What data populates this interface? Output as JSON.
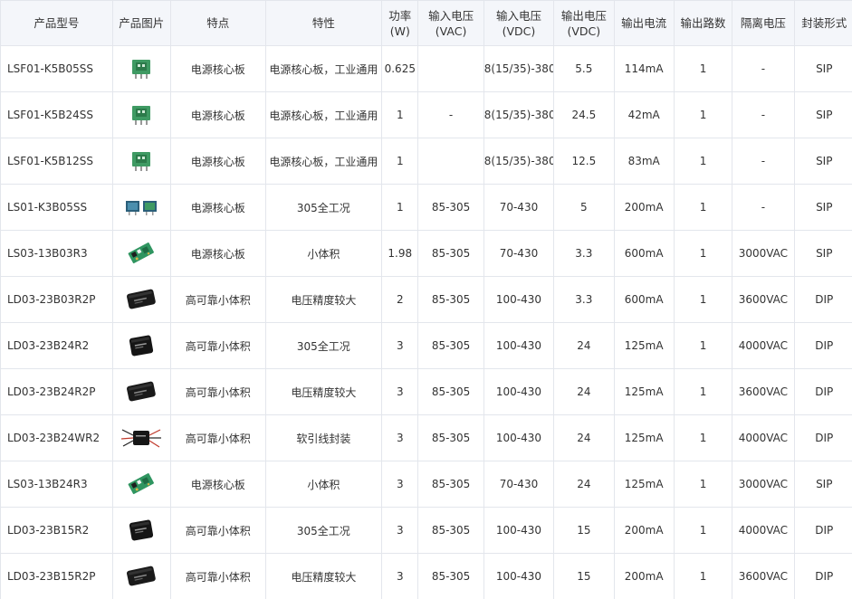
{
  "table": {
    "headers": [
      "产品型号",
      "产品图片",
      "特点",
      "特性",
      "功率\n(W)",
      "输入电压\n(VAC)",
      "输入电压\n(VDC)",
      "输出电压\n(VDC)",
      "输出电流",
      "输出路数",
      "隔离电压",
      "封装形式"
    ],
    "rows": [
      {
        "model": "LSF01-K5B05SS",
        "image": "green-sip-module-icon",
        "feature": "电源核心板",
        "character": "电源核心板，工业通用",
        "power": "0.625",
        "vac": "",
        "vdc": "8(15/35)-380",
        "vout": "5.5",
        "iout": "114mA",
        "channels": "1",
        "isolation": "-",
        "package": "SIP"
      },
      {
        "model": "LSF01-K5B24SS",
        "image": "green-sip-module-icon",
        "feature": "电源核心板",
        "character": "电源核心板，工业通用",
        "power": "1",
        "vac": "-",
        "vdc": "8(15/35)-380",
        "vout": "24.5",
        "iout": "42mA",
        "channels": "1",
        "isolation": "-",
        "package": "SIP"
      },
      {
        "model": "LSF01-K5B12SS",
        "image": "green-sip-module-icon",
        "feature": "电源核心板",
        "character": "电源核心板，工业通用",
        "power": "1",
        "vac": "",
        "vdc": "8(15/35)-380",
        "vout": "12.5",
        "iout": "83mA",
        "channels": "1",
        "isolation": "-",
        "package": "SIP"
      },
      {
        "model": "LS01-K3B05SS",
        "image": "dual-blue-module-icon",
        "feature": "电源核心板",
        "character": "305全工况",
        "power": "1",
        "vac": "85-305",
        "vdc": "70-430",
        "vout": "5",
        "iout": "200mA",
        "channels": "1",
        "isolation": "-",
        "package": "SIP"
      },
      {
        "model": "LS03-13B03R3",
        "image": "green-pcb-module-icon",
        "feature": "电源核心板",
        "character": "小体积",
        "power": "1.98",
        "vac": "85-305",
        "vdc": "70-430",
        "vout": "3.3",
        "iout": "600mA",
        "channels": "1",
        "isolation": "3000VAC",
        "package": "SIP"
      },
      {
        "model": "LD03-23B03R2P",
        "image": "black-dip-module-icon",
        "feature": "高可靠小体积",
        "character": "电压精度较大",
        "power": "2",
        "vac": "85-305",
        "vdc": "100-430",
        "vout": "3.3",
        "iout": "600mA",
        "channels": "1",
        "isolation": "3600VAC",
        "package": "DIP"
      },
      {
        "model": "LD03-23B24R2",
        "image": "black-cube-module-icon",
        "feature": "高可靠小体积",
        "character": "305全工况",
        "power": "3",
        "vac": "85-305",
        "vdc": "100-430",
        "vout": "24",
        "iout": "125mA",
        "channels": "1",
        "isolation": "4000VAC",
        "package": "DIP"
      },
      {
        "model": "LD03-23B24R2P",
        "image": "black-dip-module-icon",
        "feature": "高可靠小体积",
        "character": "电压精度较大",
        "power": "3",
        "vac": "85-305",
        "vdc": "100-430",
        "vout": "24",
        "iout": "125mA",
        "channels": "1",
        "isolation": "3600VAC",
        "package": "DIP"
      },
      {
        "model": "LD03-23B24WR2",
        "image": "wired-module-icon",
        "feature": "高可靠小体积",
        "character": "软引线封装",
        "power": "3",
        "vac": "85-305",
        "vdc": "100-430",
        "vout": "24",
        "iout": "125mA",
        "channels": "1",
        "isolation": "4000VAC",
        "package": "DIP"
      },
      {
        "model": "LS03-13B24R3",
        "image": "green-pcb-module-icon",
        "feature": "电源核心板",
        "character": "小体积",
        "power": "3",
        "vac": "85-305",
        "vdc": "70-430",
        "vout": "24",
        "iout": "125mA",
        "channels": "1",
        "isolation": "3000VAC",
        "package": "SIP"
      },
      {
        "model": "LD03-23B15R2",
        "image": "black-cube-module-icon",
        "feature": "高可靠小体积",
        "character": "305全工况",
        "power": "3",
        "vac": "85-305",
        "vdc": "100-430",
        "vout": "15",
        "iout": "200mA",
        "channels": "1",
        "isolation": "4000VAC",
        "package": "DIP"
      },
      {
        "model": "LD03-23B15R2P",
        "image": "black-dip-module-icon",
        "feature": "高可靠小体积",
        "character": "电压精度较大",
        "power": "3",
        "vac": "85-305",
        "vdc": "100-430",
        "vout": "15",
        "iout": "200mA",
        "channels": "1",
        "isolation": "3600VAC",
        "package": "DIP"
      }
    ]
  },
  "colors": {
    "header_bg": "#f4f6fa",
    "border": "#e3e6ec",
    "text": "#333333"
  }
}
